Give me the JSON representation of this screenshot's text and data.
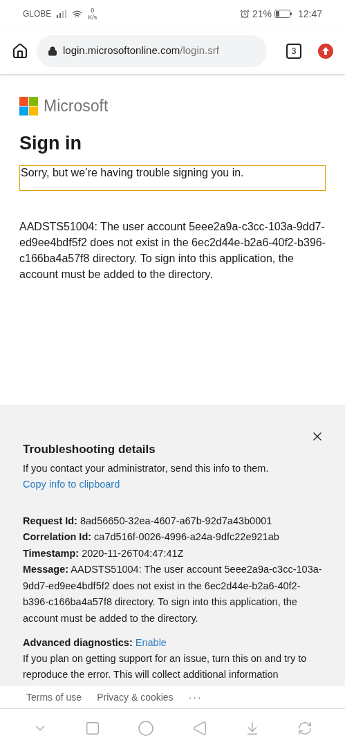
{
  "status_bar": {
    "carrier": "GLOBE",
    "speed_value": "0",
    "speed_unit": "K/s",
    "battery": "21%",
    "time": "12:47"
  },
  "browser": {
    "url_host": "login.microsoftonline.com",
    "url_path": "/login.srf",
    "tab_count": "3"
  },
  "page": {
    "brand": "Microsoft",
    "title": "Sign in",
    "error_banner": "Sorry, but we’re having trouble signing you in.",
    "error_detail": "AADSTS51004: The user account 5eee2a9a-c3cc-103a-9dd7-ed9ee4bdf5f2 does not exist in the 6ec2d44e-b2a6-40f2-b396-c166ba4a57f8 directory. To sign into this application, the account must be added to the directory."
  },
  "troubleshooting": {
    "title": "Troubleshooting details",
    "intro": "If you contact your administrator, send this info to them.",
    "copy_link": "Copy info to clipboard",
    "details": [
      "**Request Id:** 8ad56650-32ea-4607-a67b-92d7a43b0001",
      "**Correlation Id:** ca7d516f-0026-4996-a24a-9dfc22e921ab",
      "**Timestamp:** 2020-11-26T04:47:41Z",
      "**Message:** AADSTS51004: The user account 5eee2a9a-c3cc-103a-9dd7-ed9ee4bdf5f2 does not exist in the 6ec2d44e-b2a6-40f2-b396-c166ba4a57f8 directory. To sign into this application, the account must be added to the directory."
    ],
    "advanced_label": "Advanced diagnostics:",
    "advanced_link": "Enable",
    "advanced_text": "If you plan on getting support for an issue, turn this on and try to reproduce the error. This will collect additional information"
  },
  "footer": {
    "links": [
      "Terms of use",
      "Privacy & cookies"
    ],
    "more": "···"
  }
}
